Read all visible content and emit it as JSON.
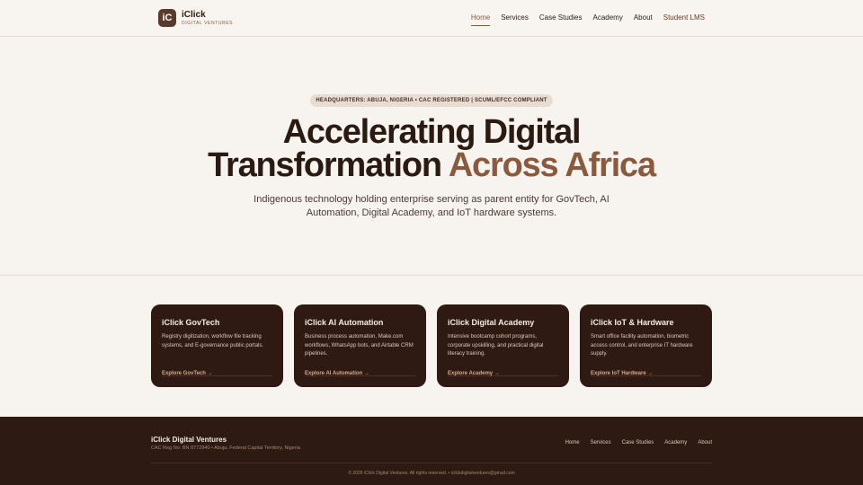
{
  "header": {
    "logo_mark": "iC",
    "logo_name": "iClick",
    "logo_sub": "DIGITAL VENTURES",
    "nav": [
      "Home",
      "Services",
      "Case Studies",
      "Academy",
      "About",
      "Student LMS"
    ]
  },
  "hero": {
    "badge": "HEADQUARTERS: ABUJA, NIGERIA • CAC REGISTERED | SCUML/EFCC COMPLIANT",
    "title_line1": "Accelerating Digital",
    "title_line2": "Transformation ",
    "title_accent": "Across Africa",
    "subtitle": "Indigenous technology holding enterprise serving as parent entity for GovTech, AI Automation, Digital Academy, and IoT hardware systems."
  },
  "cards": [
    {
      "title": "iClick GovTech",
      "desc": "Registry digitization, workflow file tracking systems, and E-governance public portals.",
      "link": "Explore GovTech →"
    },
    {
      "title": "iClick AI Automation",
      "desc": "Business process automation, Make.com workflows, WhatsApp bots, and Airtable CRM pipelines.",
      "link": "Explore AI Automation →"
    },
    {
      "title": "iClick Digital Academy",
      "desc": "Intensive bootcamp cohort programs, corporate upskilling, and practical digital literacy training.",
      "link": "Explore Academy →"
    },
    {
      "title": "iClick IoT & Hardware",
      "desc": "Smart office facility automation, biometric access control, and enterprise IT hardware supply.",
      "link": "Explore IoT Hardware →"
    }
  ],
  "footer": {
    "brand": "iClick Digital Ventures",
    "reg": "CAC Reg No: BN 8772940 • Abuja, Federal Capital Territory, Nigeria",
    "nav": [
      "Home",
      "Services",
      "Case Studies",
      "Academy",
      "About"
    ],
    "copy": "© 2026 iClick Digital Ventures. All rights reserved. • iclickdigitalventures@gmail.com"
  },
  "colors": {
    "brand_dark": "#2e1a12",
    "accent": "#8a5a3e",
    "background": "#f7f3ef"
  }
}
